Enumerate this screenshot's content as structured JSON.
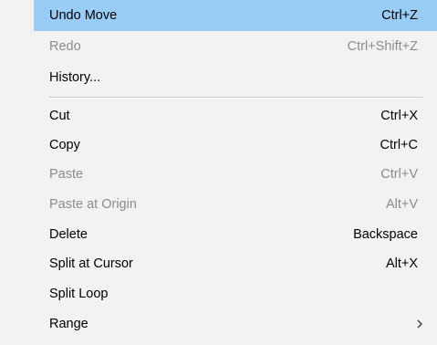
{
  "menu": {
    "undo_move": {
      "label": "Undo Move",
      "shortcut": "Ctrl+Z"
    },
    "redo": {
      "label": "Redo",
      "shortcut": "Ctrl+Shift+Z"
    },
    "history": {
      "label": "History..."
    },
    "cut": {
      "label": "Cut",
      "shortcut": "Ctrl+X"
    },
    "copy": {
      "label": "Copy",
      "shortcut": "Ctrl+C"
    },
    "paste": {
      "label": "Paste",
      "shortcut": "Ctrl+V"
    },
    "paste_at_origin": {
      "label": "Paste at Origin",
      "shortcut": "Alt+V"
    },
    "delete": {
      "label": "Delete",
      "shortcut": "Backspace"
    },
    "split_at_cursor": {
      "label": "Split at Cursor",
      "shortcut": "Alt+X"
    },
    "split_loop": {
      "label": "Split Loop"
    },
    "range": {
      "label": "Range",
      "submenu_icon": "chevron-right-icon"
    }
  },
  "colors": {
    "menu_background": "#f2f2f2",
    "highlight": "#99ccf6",
    "disabled_text": "#8c8c8c",
    "enabled_text": "#000000"
  }
}
